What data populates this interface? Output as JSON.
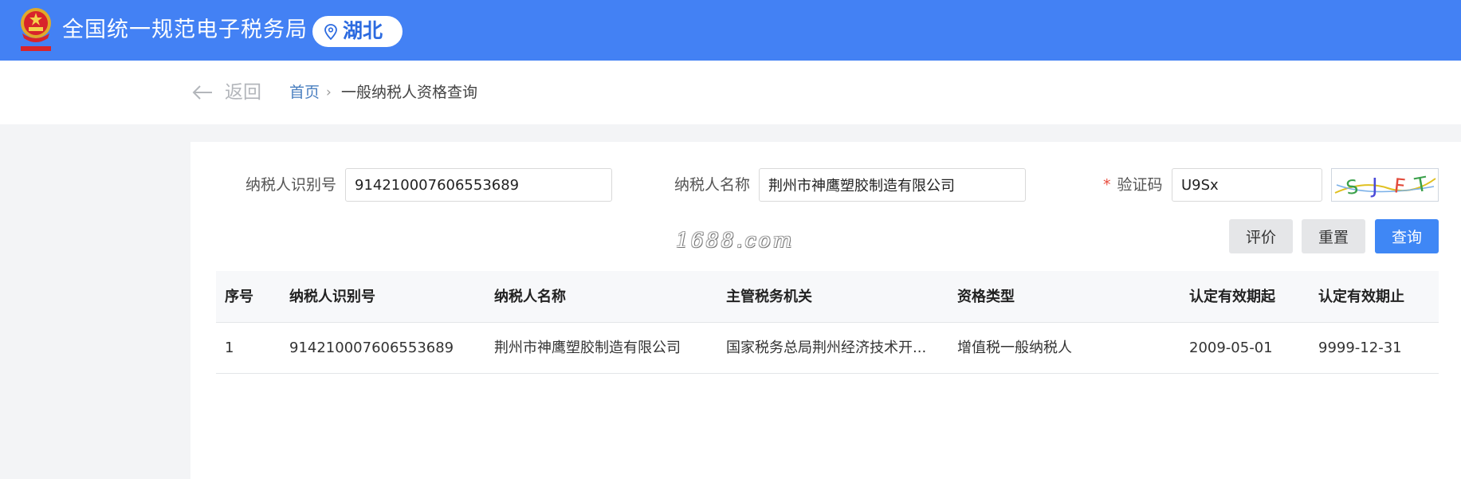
{
  "header": {
    "title": "全国统一规范电子税务局",
    "region": "湖北",
    "emblem_icon": "national-emblem-icon",
    "pin_icon": "location-pin-icon",
    "color": "#4381f4"
  },
  "nav": {
    "back_label": "返回",
    "breadcrumb": {
      "home": "首页",
      "separator": "›",
      "current": "一般纳税人资格查询"
    }
  },
  "form": {
    "taxpayer_id_label": "纳税人识别号",
    "taxpayer_id_value": "914210007606553689",
    "taxpayer_name_label": "纳税人名称",
    "taxpayer_name_value": "荆州市神鹰塑胶制造有限公司",
    "captcha_required_mark": "*",
    "captcha_label": "验证码",
    "captcha_value": "U9Sx",
    "captcha_image_text": "SJFT"
  },
  "buttons": {
    "evaluate": "评价",
    "reset": "重置",
    "query": "查询",
    "primary_color": "#3f87f5"
  },
  "watermark": "1688.com",
  "table": {
    "columns": [
      "序号",
      "纳税人识别号",
      "纳税人名称",
      "主管税务机关",
      "资格类型",
      "认定有效期起",
      "认定有效期止"
    ],
    "rows": [
      [
        "1",
        "914210007606553689",
        "荆州市神鹰塑胶制造有限公司",
        "国家税务总局荆州经济技术开...",
        "增值税一般纳税人",
        "2009-05-01",
        "9999-12-31"
      ]
    ]
  }
}
